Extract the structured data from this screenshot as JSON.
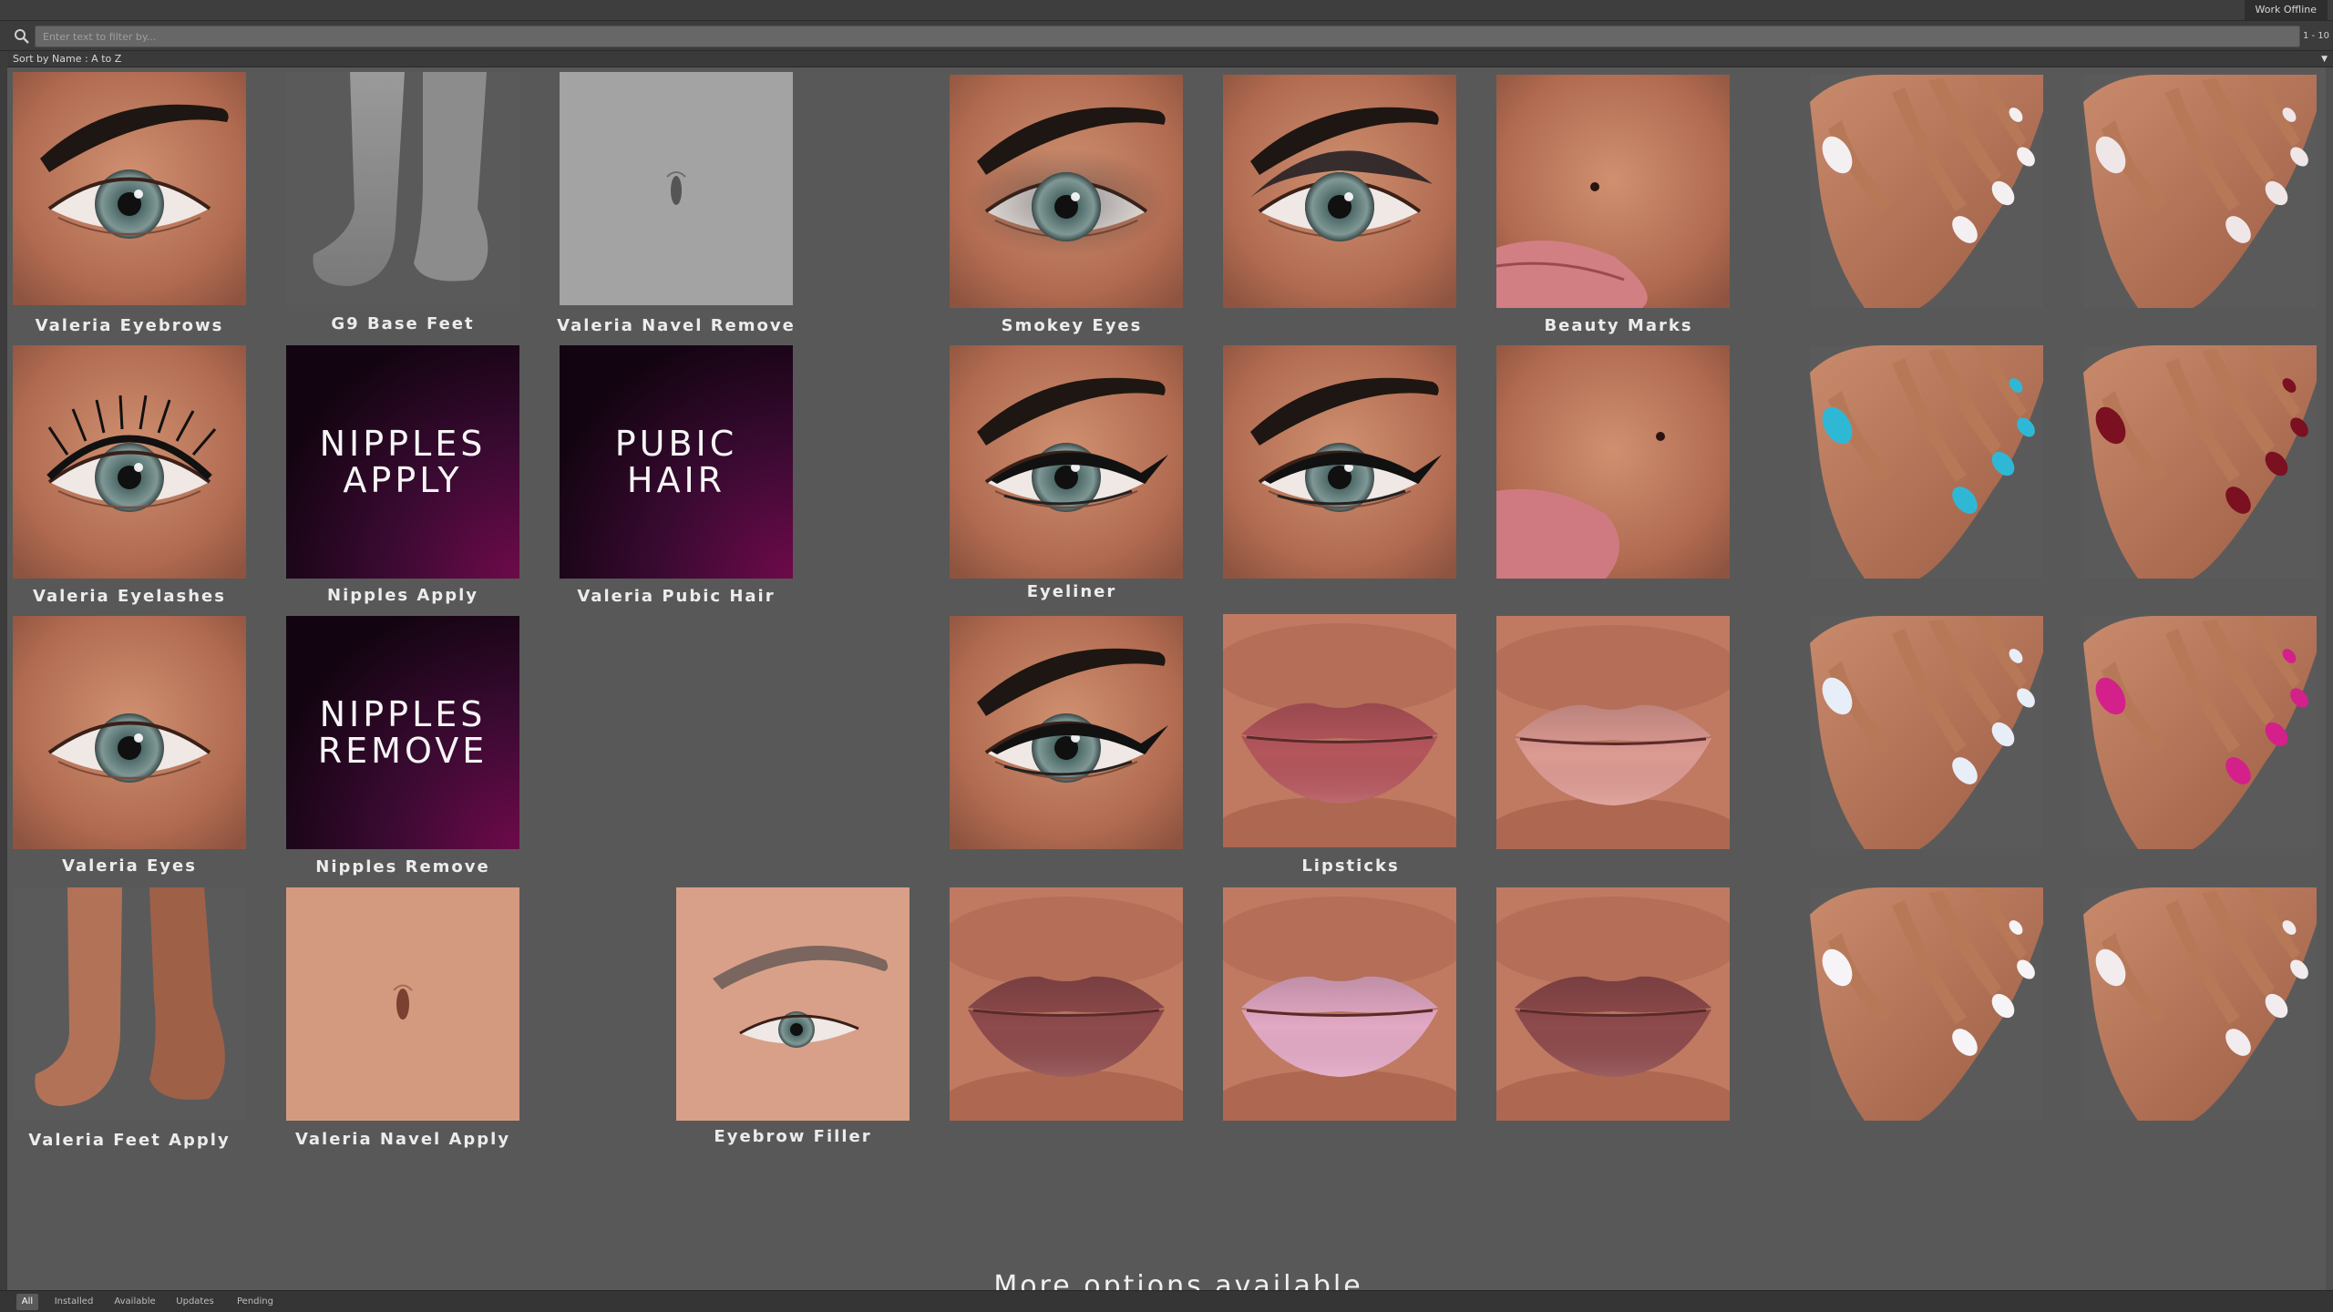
{
  "window": {
    "work_offline": "Work Offline",
    "page_range": "1 - 10"
  },
  "filter": {
    "placeholder": "Enter text to filter by..."
  },
  "sort": {
    "label": "Sort by Name : A to Z"
  },
  "items": {
    "valeria_eyebrows": "Valeria Eyebrows",
    "g9_base_feet": "G9 Base Feet",
    "valeria_navel_remove": "Valeria Navel Remove",
    "smokey_eyes": "Smokey Eyes",
    "beauty_marks": "Beauty Marks",
    "valeria_eyelashes": "Valeria Eyelashes",
    "nipples_apply": "Nipples Apply",
    "valeria_pubic_hair": "Valeria Pubic Hair",
    "eyeliner": "Eyeliner",
    "valeria_eyes": "Valeria Eyes",
    "nipples_remove": "Nipples Remove",
    "lipsticks": "Lipsticks",
    "valeria_feet_apply": "Valeria Feet Apply",
    "valeria_navel_apply": "Valeria Navel Apply",
    "eyebrow_filler": "Eyebrow Filler"
  },
  "thumb_text": {
    "nipples_apply_1": "NIPPLES",
    "nipples_apply_2": "APPLY",
    "pubic_hair_1": "PUBIC",
    "pubic_hair_2": "HAIR",
    "nipples_remove_1": "NIPPLES",
    "nipples_remove_2": "REMOVE"
  },
  "footer": {
    "more_options": "More options available"
  },
  "tabs": [
    "All",
    "Installed",
    "Available",
    "Updates",
    "Pending"
  ],
  "colors": {
    "nail_white": "#f4f0f2",
    "nail_teal": "#2fb8d6",
    "nail_red": "#7a1020",
    "nail_pink": "#d4208a",
    "nail_pastel": "#e8eef8",
    "lip_red": "#b4565c",
    "lip_nude": "#dc9a92",
    "lip_plum": "#8e4a4c",
    "lip_pink": "#e2a8c4"
  }
}
